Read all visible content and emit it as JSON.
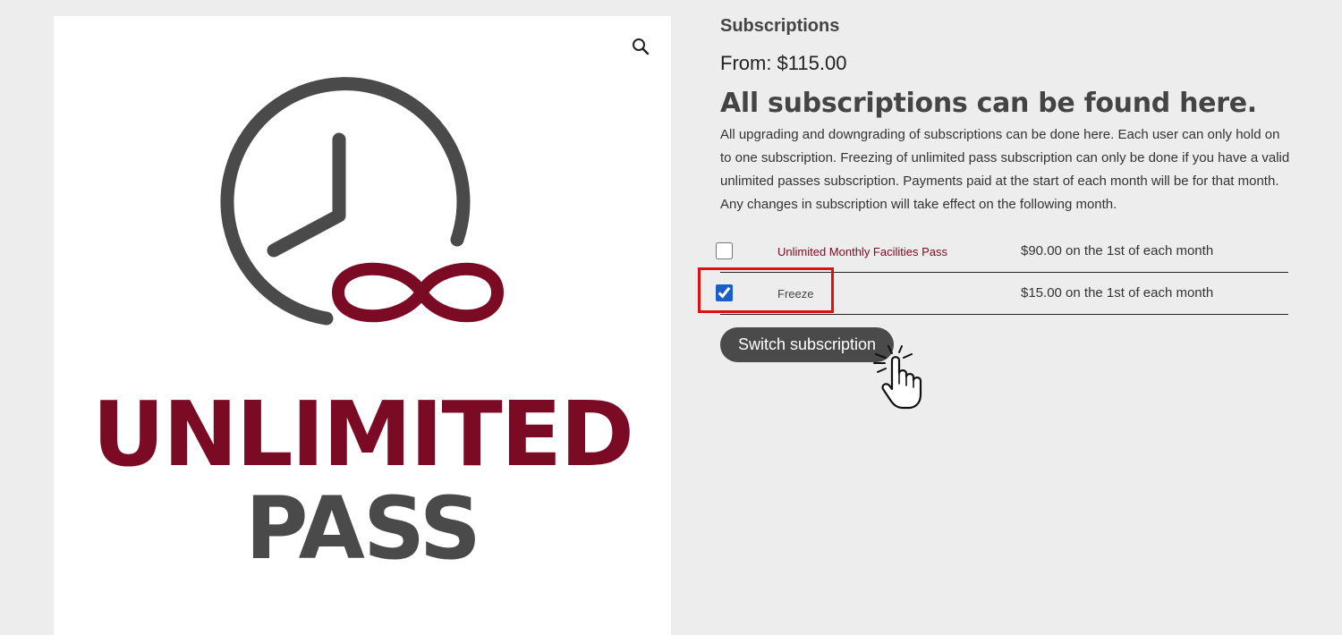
{
  "product_image": {
    "logo_line1": "UNLIMITED",
    "logo_line2": "PASS",
    "zoom_icon": "magnifier-icon"
  },
  "summary": {
    "category_title": "Subscriptions",
    "price": "From: $115.00",
    "headline": "All subscriptions can be found here.",
    "description": "All upgrading and downgrading of subscriptions can be done here. Each user can only hold on to one subscription. Freezing of unlimited pass subscription can only be done if you have a valid unlimited passes subscription. Payments paid at the start of each month will be for that month. Any changes in subscription will take effect on the following month."
  },
  "options": [
    {
      "name": "Unlimited Monthly Facilities Pass",
      "price": "$90.00 on the 1st of each month",
      "checked": false
    },
    {
      "name": "Freeze",
      "price": "$15.00 on the 1st of each month",
      "checked": true
    }
  ],
  "actions": {
    "switch_label": "Switch subscription"
  },
  "colors": {
    "brand_maroon": "#7b0a24",
    "dark_gray": "#4a4a4a",
    "highlight_red": "#e01010",
    "checkbox_blue": "#1a5fc9"
  }
}
